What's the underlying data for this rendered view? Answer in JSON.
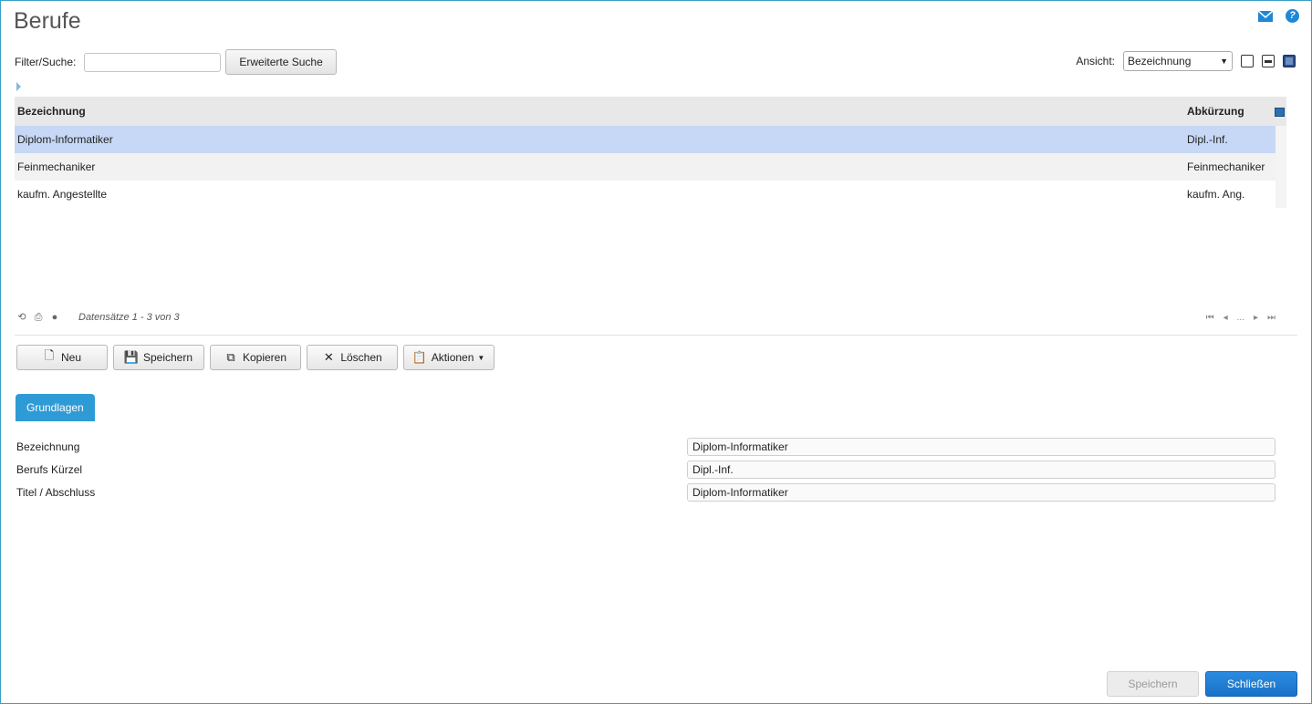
{
  "page": {
    "title": "Berufe"
  },
  "filter": {
    "label": "Filter/Suche:",
    "value": "",
    "placeholder": "",
    "extended_search_label": "Erweiterte Suche"
  },
  "view": {
    "label": "Ansicht:",
    "selected": "Bezeichnung"
  },
  "grid": {
    "columns": [
      "Bezeichnung",
      "Abkürzung"
    ],
    "rows": [
      {
        "bezeichnung": "Diplom-Informatiker",
        "abkuerzung": "Dipl.-Inf.",
        "selected": true
      },
      {
        "bezeichnung": "Feinmechaniker",
        "abkuerzung": "Feinmechaniker",
        "selected": false
      },
      {
        "bezeichnung": "kaufm. Angestellte",
        "abkuerzung": "kaufm. Ang.",
        "selected": false
      }
    ]
  },
  "pager": {
    "info": "Datensätze 1 - 3 von 3",
    "ellipsis": "..."
  },
  "toolbar": {
    "new": "Neu",
    "save": "Speichern",
    "copy": "Kopieren",
    "delete": "Löschen",
    "actions": "Aktionen"
  },
  "tabs": [
    {
      "label": "Grundlagen",
      "active": true
    }
  ],
  "form": {
    "fields": [
      {
        "label": "Bezeichnung",
        "value": "Diplom-Informatiker"
      },
      {
        "label": "Berufs Kürzel",
        "value": "Dipl.-Inf."
      },
      {
        "label": "Titel / Abschluss",
        "value": "Diplom-Informatiker"
      }
    ]
  },
  "footer": {
    "save": "Speichern",
    "close": "Schließen"
  },
  "icons": {
    "mail": "mail-icon",
    "help": "help-icon"
  },
  "colors": {
    "accent": "#2f9bd6",
    "selected_row": "#c6d8f5",
    "primary_button": "#1a72c7"
  }
}
